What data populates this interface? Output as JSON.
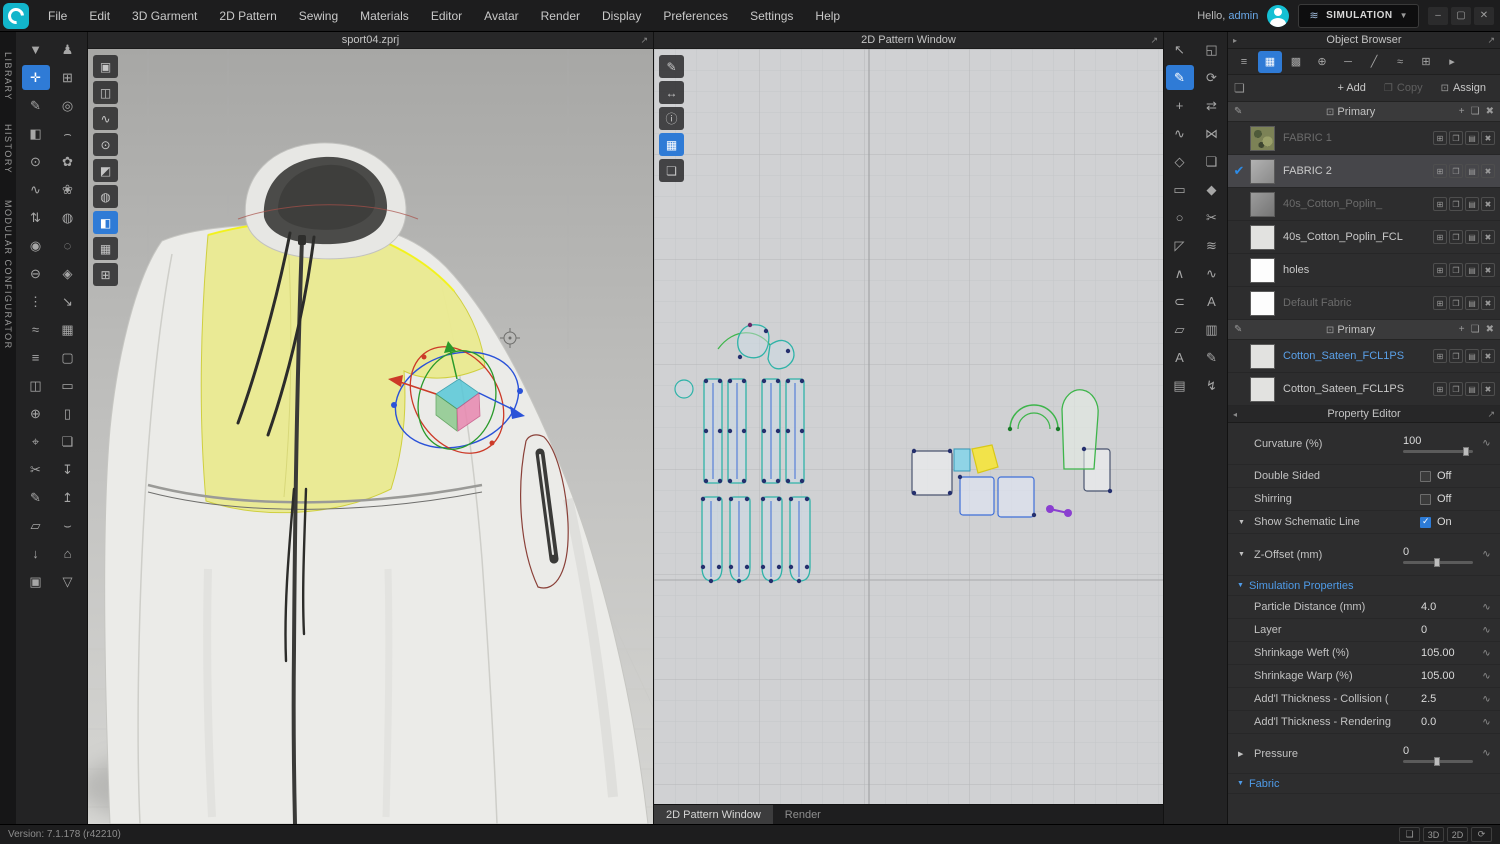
{
  "menubar": {
    "items": [
      "File",
      "Edit",
      "3D Garment",
      "2D Pattern",
      "Sewing",
      "Materials",
      "Editor",
      "Avatar",
      "Render",
      "Display",
      "Preferences",
      "Settings",
      "Help"
    ],
    "hello_prefix": "Hello,",
    "username": "admin",
    "mode_label": "SIMULATION",
    "window_icons": [
      {
        "name": "minimize-icon",
        "glyph": "–"
      },
      {
        "name": "maximize-icon",
        "glyph": "▢"
      },
      {
        "name": "close-icon",
        "glyph": "✕"
      }
    ]
  },
  "left_rail": {
    "labels": [
      "LIBRARY",
      "HISTORY",
      "MODULAR CONFIGURATOR"
    ]
  },
  "left_toolbar": {
    "col1": [
      {
        "name": "simulate-icon",
        "glyph": "▼"
      },
      {
        "name": "select-move-icon",
        "glyph": "✛",
        "active": true
      },
      {
        "name": "pen-icon",
        "glyph": "✎"
      },
      {
        "name": "edit-texture-icon",
        "glyph": "◧"
      },
      {
        "name": "pin-icon",
        "glyph": "⊙"
      },
      {
        "name": "sewing-icon",
        "glyph": "∿"
      },
      {
        "name": "zipper-icon",
        "glyph": "⇅"
      },
      {
        "name": "button-icon",
        "glyph": "◉"
      },
      {
        "name": "buttonhole-icon",
        "glyph": "⊖"
      },
      {
        "name": "topstitch-icon",
        "glyph": "⋮"
      },
      {
        "name": "puckering-icon",
        "glyph": "≈"
      },
      {
        "name": "pleats-icon",
        "glyph": "≡"
      },
      {
        "name": "binding-icon",
        "glyph": "◫"
      },
      {
        "name": "tack-icon",
        "glyph": "⊕"
      },
      {
        "name": "measure-icon",
        "glyph": "⌖"
      },
      {
        "name": "scissors-icon",
        "glyph": "✂"
      },
      {
        "name": "draw-3d-icon",
        "glyph": "✎"
      },
      {
        "name": "flatten-icon",
        "glyph": "▱"
      },
      {
        "name": "drop-arrow-icon",
        "glyph": "↓"
      },
      {
        "name": "garment-icon",
        "glyph": "▣"
      }
    ],
    "col2": [
      {
        "name": "avatar-tool-icon",
        "glyph": "♟"
      },
      {
        "name": "arrange-avatar-icon",
        "glyph": "⊞"
      },
      {
        "name": "show-avatar-icon",
        "glyph": "◎"
      },
      {
        "name": "tape-icon",
        "glyph": "⌢"
      },
      {
        "name": "flower-pose-icon",
        "glyph": "✿"
      },
      {
        "name": "flower-pose-b-icon",
        "glyph": "❀"
      },
      {
        "name": "sphere-icon",
        "glyph": "◍"
      },
      {
        "name": "drape-icon",
        "glyph": "◌"
      },
      {
        "name": "fit-icon",
        "glyph": "◈"
      },
      {
        "name": "resize-icon",
        "glyph": "↘"
      },
      {
        "name": "grid-icon",
        "glyph": "▦"
      },
      {
        "name": "box-a-icon",
        "glyph": "▢"
      },
      {
        "name": "box-b-icon",
        "glyph": "▭"
      },
      {
        "name": "box-c-icon",
        "glyph": "▯"
      },
      {
        "name": "layers-icon",
        "glyph": "❏"
      },
      {
        "name": "export-icon",
        "glyph": "↧"
      },
      {
        "name": "import-icon",
        "glyph": "↥"
      },
      {
        "name": "bend-icon",
        "glyph": "⌣"
      },
      {
        "name": "home-icon",
        "glyph": "⌂"
      },
      {
        "name": "shirt-icon",
        "glyph": "▽"
      }
    ]
  },
  "viewport3d": {
    "title": "sport04.zprj",
    "toolbar": [
      {
        "name": "show-garment-icon",
        "glyph": "▣"
      },
      {
        "name": "show-avatar-icon",
        "glyph": "◫"
      },
      {
        "name": "show-seams-icon",
        "glyph": "∿"
      },
      {
        "name": "show-pins-icon",
        "glyph": "⊙"
      },
      {
        "name": "show-strain-icon",
        "glyph": "◩"
      },
      {
        "name": "show-fit-icon",
        "glyph": "◍"
      },
      {
        "name": "texture-view-icon",
        "glyph": "◧",
        "active": true
      },
      {
        "name": "mesh-view-icon",
        "glyph": "▦"
      },
      {
        "name": "grid-view-icon",
        "glyph": "⊞"
      }
    ]
  },
  "pattern2d": {
    "title": "2D Pattern Window",
    "toolbar": [
      {
        "name": "edit-texture-icon",
        "glyph": "✎"
      },
      {
        "name": "scale-icon",
        "glyph": "↔"
      },
      {
        "name": "info-icon",
        "glyph": "ⓘ"
      },
      {
        "name": "fabric-view-icon",
        "glyph": "▦",
        "active": true
      },
      {
        "name": "layers-icon",
        "glyph": "❏"
      }
    ],
    "tabs": [
      "2D Pattern Window",
      "Render"
    ]
  },
  "right_toolbar": {
    "col1": [
      {
        "name": "transform-pattern-icon",
        "glyph": "↖"
      },
      {
        "name": "edit-pattern-icon",
        "glyph": "✎",
        "active": true
      },
      {
        "name": "add-point-icon",
        "glyph": "+"
      },
      {
        "name": "curve-edit-icon",
        "glyph": "∿"
      },
      {
        "name": "polygon-icon",
        "glyph": "◇"
      },
      {
        "name": "rectangle-icon",
        "glyph": "▭"
      },
      {
        "name": "circle-icon",
        "glyph": "○"
      },
      {
        "name": "dart-icon",
        "glyph": "◸"
      },
      {
        "name": "notch-icon",
        "glyph": "∧"
      },
      {
        "name": "seam-allowance-icon",
        "glyph": "⊂"
      },
      {
        "name": "trace-icon",
        "glyph": "▱"
      },
      {
        "name": "text-tool-icon",
        "glyph": "A"
      },
      {
        "name": "grading-icon",
        "glyph": "▤"
      }
    ],
    "col2": [
      {
        "name": "pattern-3d-sync-icon",
        "glyph": "◱"
      },
      {
        "name": "sync-icon",
        "glyph": "⟳"
      },
      {
        "name": "mirror-icon",
        "glyph": "⇄"
      },
      {
        "name": "unfold-icon",
        "glyph": "⋈"
      },
      {
        "name": "clone-layer-icon",
        "glyph": "❏"
      },
      {
        "name": "shape-icon",
        "glyph": "◆"
      },
      {
        "name": "cut-sew-icon",
        "glyph": "✂"
      },
      {
        "name": "pleat-icon",
        "glyph": "≋"
      },
      {
        "name": "zigzag-icon",
        "glyph": "∿"
      },
      {
        "name": "text-b-icon",
        "glyph": "A"
      },
      {
        "name": "ruler-icon",
        "glyph": "▥"
      },
      {
        "name": "annotate-icon",
        "glyph": "✎"
      },
      {
        "name": "flash-icon",
        "glyph": "↯"
      }
    ]
  },
  "object_browser": {
    "title": "Object Browser",
    "tabs_icons": [
      {
        "name": "list-view-icon",
        "glyph": "≡"
      },
      {
        "name": "fabric-tab-icon",
        "glyph": "▦",
        "active": true
      },
      {
        "name": "pattern-tab-icon",
        "glyph": "▩"
      },
      {
        "name": "button-tab-icon",
        "glyph": "⊕"
      },
      {
        "name": "line-tab-icon",
        "glyph": "─"
      },
      {
        "name": "piping-tab-icon",
        "glyph": "╱"
      },
      {
        "name": "stitch-tab-icon",
        "glyph": "≈"
      },
      {
        "name": "trim-tab-icon",
        "glyph": "⊞"
      },
      {
        "name": "more-tab-icon",
        "glyph": "▸"
      }
    ],
    "actions": {
      "add": "+ Add",
      "copy": "Copy",
      "assign": "Assign"
    },
    "section_label": "Primary",
    "row_icons": [
      {
        "name": "row-add-icon",
        "glyph": "⊞"
      },
      {
        "name": "row-copy-icon",
        "glyph": "❐"
      },
      {
        "name": "row-info-icon",
        "glyph": "▤"
      },
      {
        "name": "row-delete-icon",
        "glyph": "✖"
      }
    ],
    "fabrics": [
      {
        "name": "FABRIC 1",
        "dimmed": true,
        "selected": false
      },
      {
        "name": "FABRIC 2",
        "dimmed": false,
        "selected": true
      },
      {
        "name": "40s_Cotton_Poplin_",
        "dimmed": true,
        "selected": false
      },
      {
        "name": "40s_Cotton_Poplin_FCL",
        "dimmed": false,
        "selected": false
      },
      {
        "name": "holes",
        "dimmed": false,
        "selected": false
      },
      {
        "name": "Default Fabric",
        "dimmed": true,
        "selected": false
      }
    ],
    "fabrics2": [
      {
        "name": "Cotton_Sateen_FCL1PS",
        "link": true
      },
      {
        "name": "Cotton_Sateen_FCL1PS",
        "link": false
      }
    ]
  },
  "property_editor": {
    "title": "Property Editor",
    "curvature_label": "Curvature (%)",
    "curvature_value": "100",
    "double_sided_label": "Double Sided",
    "double_sided_value": "Off",
    "shirring_label": "Shirring",
    "shirring_value": "Off",
    "schematic_label": "Show Schematic Line",
    "schematic_value": "On",
    "zoffset_label": "Z-Offset (mm)",
    "zoffset_value": "0",
    "sim_title": "Simulation Properties",
    "particle_label": "Particle Distance (mm)",
    "particle_value": "4.0",
    "layer_label": "Layer",
    "layer_value": "0",
    "weft_label": "Shrinkage Weft (%)",
    "weft_value": "105.00",
    "warp_label": "Shrinkage Warp (%)",
    "warp_value": "105.00",
    "collision_label": "Add'l Thickness - Collision (",
    "collision_value": "2.5",
    "rendering_label": "Add'l Thickness - Rendering",
    "rendering_value": "0.0",
    "pressure_label": "Pressure",
    "pressure_value": "0",
    "fabric_title": "Fabric"
  },
  "statusbar": {
    "version": "Version: 7.1.178 (r42210)",
    "icons": [
      {
        "name": "layout-panes-icon",
        "glyph": "❏"
      },
      {
        "name": "snapshot-3d-button",
        "glyph": "3D"
      },
      {
        "name": "snapshot-2d-button",
        "glyph": "2D"
      },
      {
        "name": "refresh-icon",
        "glyph": "⟳"
      }
    ]
  }
}
